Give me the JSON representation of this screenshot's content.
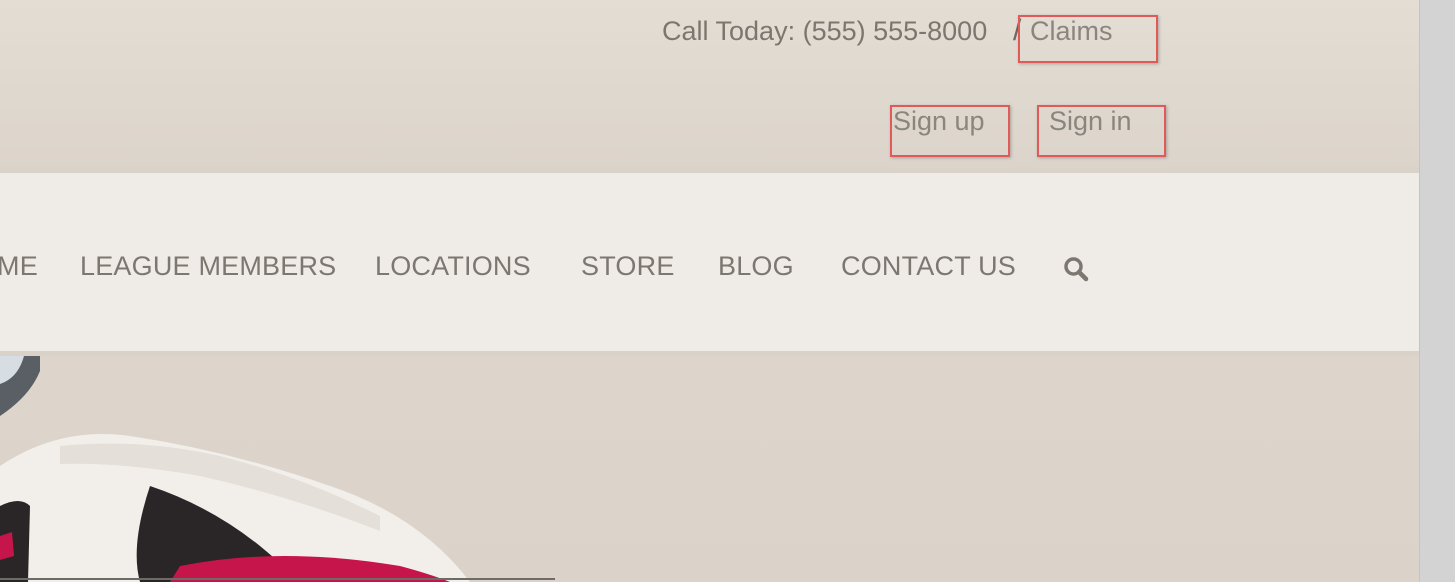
{
  "topbar": {
    "call_text": "Call Today: (555) 555-8000",
    "separator": "/",
    "claims_label": "Claims",
    "signup_label": "Sign up",
    "signin_label": "Sign in"
  },
  "nav": {
    "items": [
      "ME",
      "LEAGUE MEMBERS",
      "LOCATIONS",
      "STORE",
      "BLOG",
      "CONTACT US"
    ],
    "search_icon": "search-icon"
  },
  "colors": {
    "highlight": "#e05a5a",
    "text": "#7c7770",
    "nav_bg": "#efebe6"
  }
}
